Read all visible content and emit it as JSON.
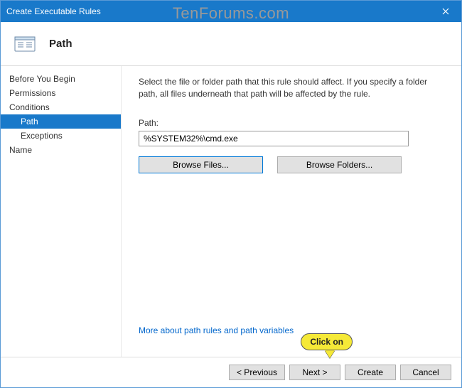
{
  "titlebar": {
    "title": "Create Executable Rules"
  },
  "header": {
    "page_title": "Path"
  },
  "sidebar": {
    "items": [
      {
        "label": "Before You Begin",
        "indent": false,
        "selected": false
      },
      {
        "label": "Permissions",
        "indent": false,
        "selected": false
      },
      {
        "label": "Conditions",
        "indent": false,
        "selected": false
      },
      {
        "label": "Path",
        "indent": true,
        "selected": true
      },
      {
        "label": "Exceptions",
        "indent": true,
        "selected": false
      },
      {
        "label": "Name",
        "indent": false,
        "selected": false
      }
    ]
  },
  "main": {
    "description": "Select the file or folder path that this rule should affect. If you specify a folder path, all files underneath that path will be affected by the rule.",
    "path_label": "Path:",
    "path_value": "%SYSTEM32%\\cmd.exe",
    "browse_files": "Browse Files...",
    "browse_folders": "Browse Folders...",
    "help_link": "More about path rules and path variables"
  },
  "footer": {
    "previous": "< Previous",
    "next": "Next >",
    "create": "Create",
    "cancel": "Cancel"
  },
  "watermark": "TenForums.com",
  "callout": {
    "text": "Click on"
  }
}
